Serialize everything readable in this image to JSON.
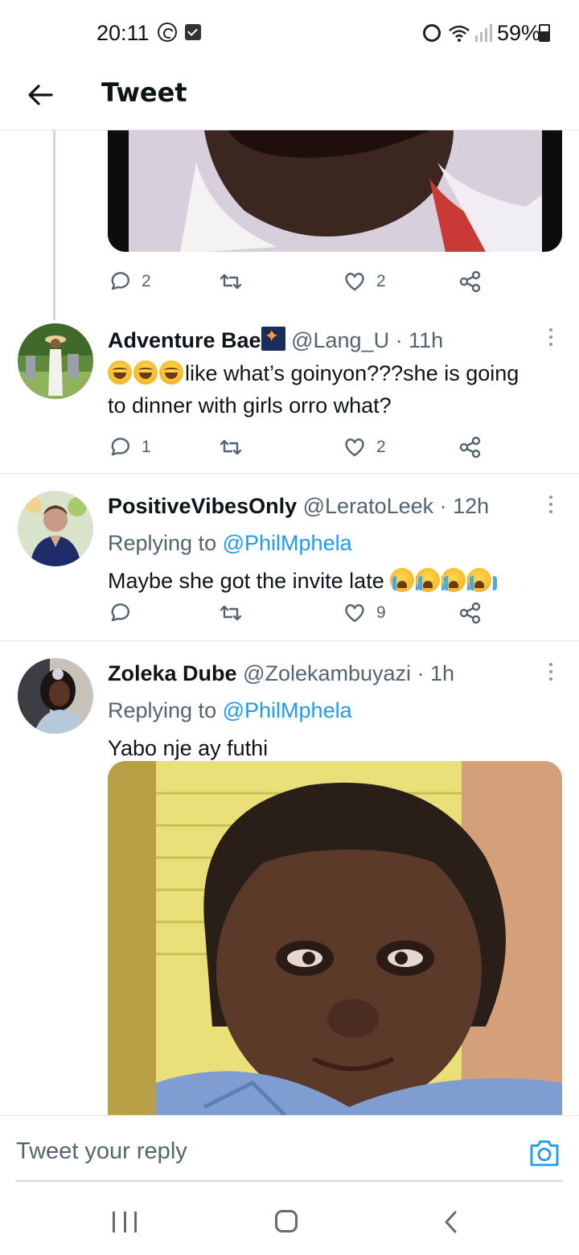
{
  "status_bar": {
    "time": "20:11",
    "battery": "59%"
  },
  "header": {
    "title": "Tweet"
  },
  "prev_tweet": {
    "reply_count": "2",
    "like_count": "2"
  },
  "tweets": [
    {
      "name": "Adventure Bae",
      "handle": "@Lang_U · 11h",
      "text_line1": "like what’s goinyon???she is going",
      "text_line2": "to dinner with girls orro what?",
      "reply_count": "1",
      "like_count": "2"
    },
    {
      "name": "PositiveVibesOnly",
      "handle": "@LeratoLeek · 12h",
      "replying_prefix": "Replying to",
      "replying_to": "@PhilMphela",
      "text": "Maybe she got the invite late",
      "reply_count": "",
      "like_count": "9"
    },
    {
      "name": "Zoleka Dube",
      "handle": "@Zolekambuyazi · 1h",
      "replying_prefix": "Replying to",
      "replying_to": "@PhilMphela",
      "text": "Yabo nje ay futhi"
    }
  ],
  "reply_bar": {
    "placeholder": "Tweet your reply"
  },
  "icons": {
    "reply": "reply-bubble-icon",
    "retweet": "retweet-icon",
    "like": "heart-icon",
    "share": "share-icon",
    "more": "more-vertical-icon",
    "camera": "camera-icon"
  },
  "colors": {
    "accent": "#1d9bf0",
    "secondary_text": "#536471",
    "divider": "#e6e9eb"
  }
}
